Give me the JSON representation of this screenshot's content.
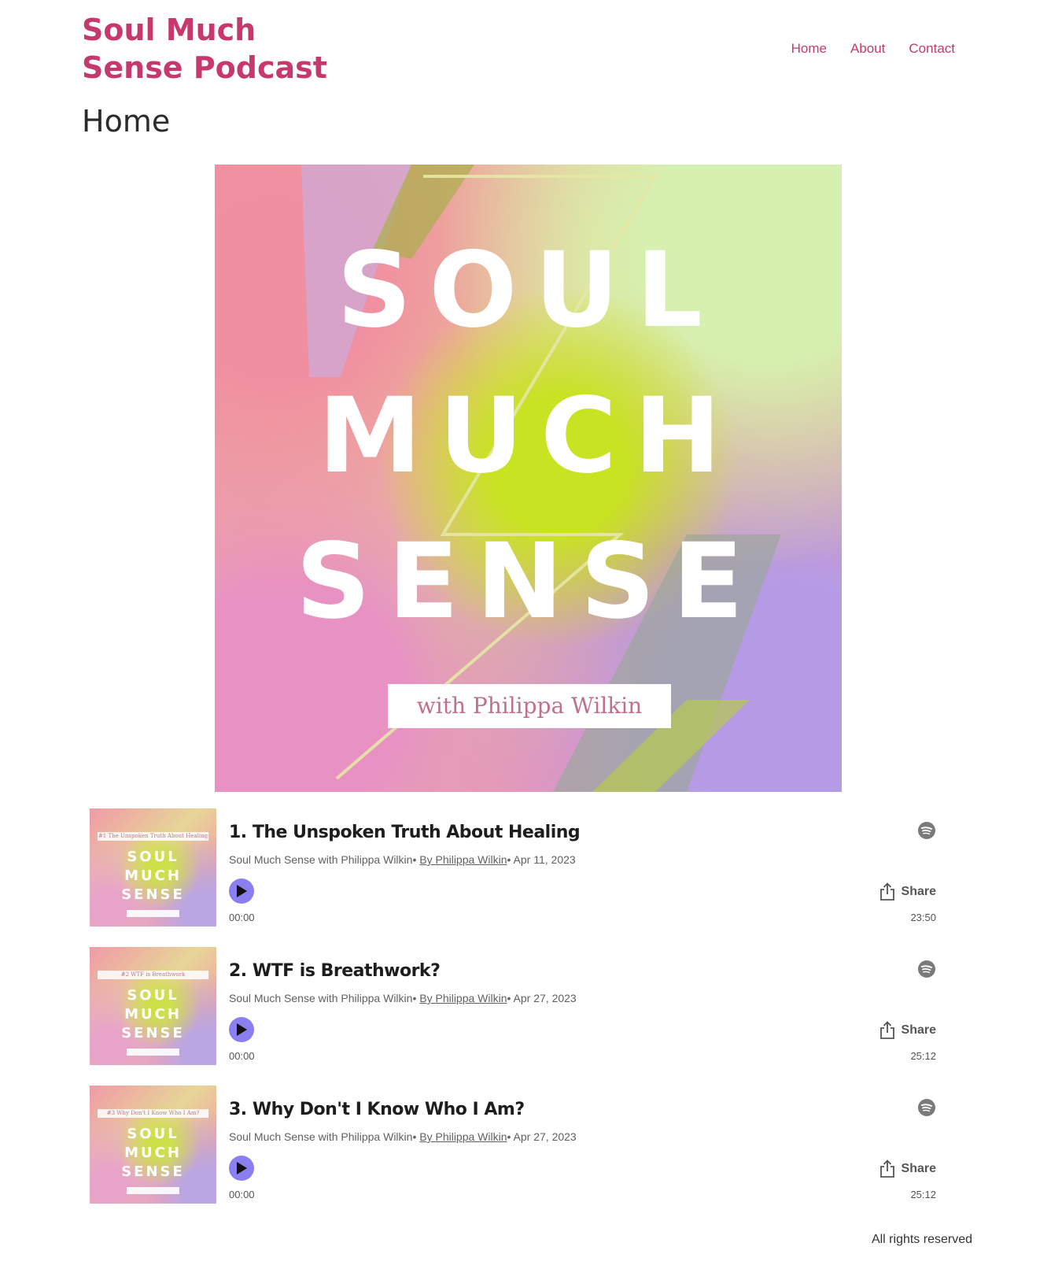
{
  "header": {
    "site_title": "Soul Much Sense Podcast",
    "nav": [
      "Home",
      "About",
      "Contact"
    ]
  },
  "page": {
    "title": "Home"
  },
  "cover": {
    "words": [
      "SOUL",
      "MUCH",
      "SENSE"
    ],
    "subtitle": "with Philippa Wilkin"
  },
  "episodes": [
    {
      "title": "1. The Unspoken Truth About Healing",
      "show": "Soul Much Sense with Philippa Wilkin",
      "sep1": "•",
      "author": "By Philippa Wilkin",
      "sep2": "•",
      "date": "Apr 11, 2023",
      "elapsed": "00:00",
      "duration": "23:50",
      "share_label": "Share",
      "thumb_caption": "#1 The Unspoken Truth About Healing"
    },
    {
      "title": "2. WTF is Breathwork?",
      "show": "Soul Much Sense with Philippa Wilkin",
      "sep1": "•",
      "author": "By Philippa Wilkin",
      "sep2": "•",
      "date": "Apr 27, 2023",
      "elapsed": "00:00",
      "duration": "25:12",
      "share_label": "Share",
      "thumb_caption": "#2 WTF is Breathwork"
    },
    {
      "title": "3. Why Don't I Know Who I Am?",
      "show": "Soul Much Sense with Philippa Wilkin",
      "sep1": "•",
      "author": "By Philippa Wilkin",
      "sep2": "•",
      "date": "Apr 27, 2023",
      "elapsed": "00:00",
      "duration": "25:12",
      "share_label": "Share",
      "thumb_caption": "#3 Why Don't I Know Who I Am?"
    }
  ],
  "footer": {
    "text": "All rights reserved"
  },
  "colors": {
    "brand": "#c7396c",
    "play": "#8b7ef0"
  },
  "icons": [
    "play-icon",
    "spotify-icon",
    "share-icon"
  ]
}
